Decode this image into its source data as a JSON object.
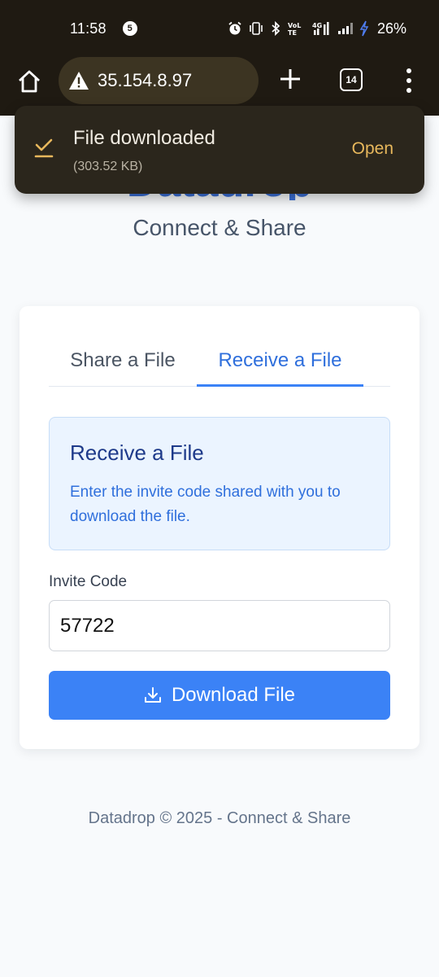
{
  "status_bar": {
    "time": "11:58",
    "notification_count": "5",
    "network_type": "4G",
    "volte_label": "VoLTE",
    "battery_percent": "26%"
  },
  "browser": {
    "url": "35.154.8.97",
    "tab_count": "14"
  },
  "toast": {
    "title": "File downloaded",
    "file_size": "(303.52 KB)",
    "action_label": "Open"
  },
  "page": {
    "logo_text": "Datadrop",
    "subtitle": "Connect & Share",
    "tabs": [
      {
        "label": "Share a File",
        "active": false
      },
      {
        "label": "Receive a File",
        "active": true
      }
    ],
    "info": {
      "title": "Receive a File",
      "text": "Enter the invite code shared with you to download the file."
    },
    "invite_label": "Invite Code",
    "invite_value": "57722",
    "download_label": "Download File",
    "footer": "Datadrop © 2025 - Connect & Share"
  },
  "colors": {
    "accent": "#3b82f6",
    "browser_bg": "#1f1a12",
    "toast_action": "#e8b85c"
  }
}
